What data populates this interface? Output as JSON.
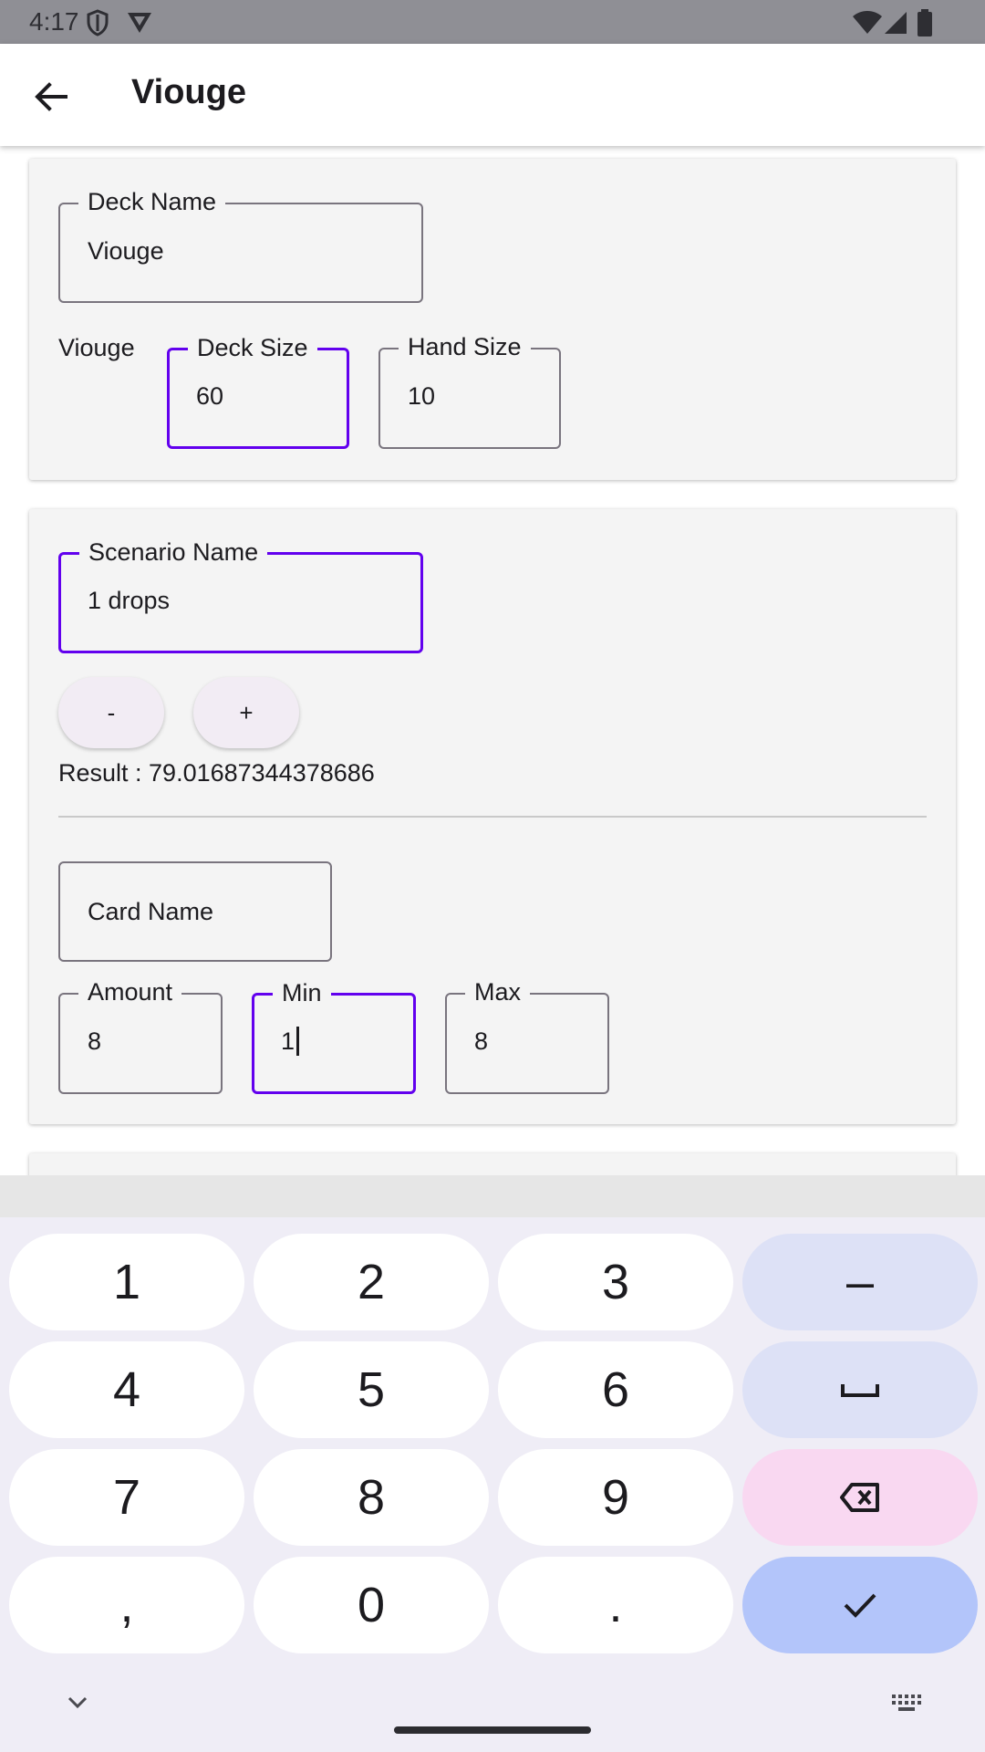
{
  "status_bar": {
    "time": "4:17",
    "icons": [
      "shield-icon",
      "vpn-icon",
      "wifi-icon",
      "signal-icon",
      "battery-icon"
    ]
  },
  "app_bar": {
    "title": "Viouge",
    "back_icon": "arrow-back-icon"
  },
  "deck_card": {
    "deck_name_label": "Deck Name",
    "deck_name_value": "Viouge",
    "deck_title": "Viouge",
    "deck_size_label": "Deck Size",
    "deck_size_value": "60",
    "hand_size_label": "Hand Size",
    "hand_size_value": "10"
  },
  "scenario_card": {
    "scenario_name_label": "Scenario Name",
    "scenario_name_value": "1 drops",
    "minus_label": "-",
    "plus_label": "+",
    "result_text": "Result : 79.01687344378686",
    "card_name_placeholder": "Card Name",
    "amount_label": "Amount",
    "amount_value": "8",
    "min_label": "Min",
    "min_value": "1",
    "max_label": "Max",
    "max_value": "8"
  },
  "keyboard": {
    "rows": [
      [
        "1",
        "2",
        "3",
        "–"
      ],
      [
        "4",
        "5",
        "6",
        "space"
      ],
      [
        "7",
        "8",
        "9",
        "backspace"
      ],
      [
        ",",
        "0",
        ".",
        "done"
      ]
    ],
    "collapse_icon": "chevron-down-icon",
    "switch_keyboard_icon": "keyboard-icon"
  },
  "colors": {
    "accent": "#6200ee",
    "card_bg": "#f4f4f4",
    "key_func": "#dde1f6",
    "key_delete": "#f9d8f1",
    "key_done": "#b3c5fa"
  }
}
